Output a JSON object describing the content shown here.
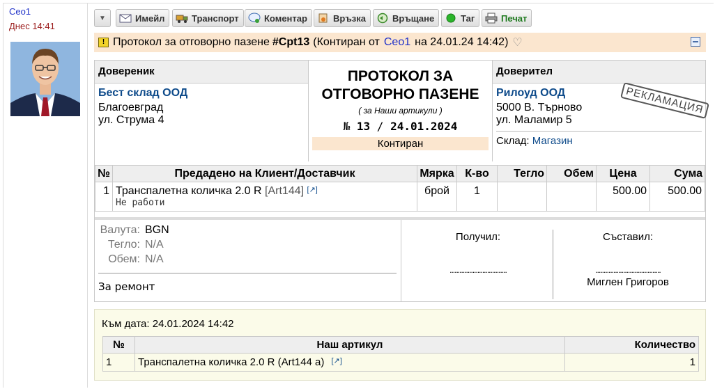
{
  "author": {
    "name": "Ceo1",
    "time": "Днес 14:41"
  },
  "toolbar": {
    "email": "Имейл",
    "transport": "Транспорт",
    "comment": "Коментар",
    "link": "Връзка",
    "return": "Връщане",
    "tag": "Таг",
    "print": "Печат"
  },
  "title": {
    "warn": "!",
    "text": "Протокол за отговорно пазене",
    "number": "#Cpt13",
    "posted_prefix": "(Контиран от",
    "posted_by": "Ceo1",
    "posted_suffix": "на 24.01.24 14:42)"
  },
  "depositor": {
    "heading": "Довереник",
    "name": "Бест склад ООД",
    "city": "Благоевград",
    "street": "ул. Струма 4"
  },
  "center": {
    "line1": "ПРОТОКОЛ ЗА",
    "line2": "ОТГОВОРНО ПАЗЕНЕ",
    "subtitle": "( за Наши артикули )",
    "no_label": "№",
    "no": "13",
    "sep": "/",
    "date": "24.01.2024",
    "status": "Контиран"
  },
  "trustee": {
    "heading": "Доверител",
    "name": "Рилоуд ООД",
    "city": "5000 В. Търново",
    "street": "ул. Маламир 5",
    "store_label": "Склад:",
    "store": "Магазин",
    "stamp": "РЕКЛАМАЦИЯ"
  },
  "items": {
    "headers": [
      "№",
      "Предадено на Клиент/Доставчик",
      "Мярка",
      "К-во",
      "Тегло",
      "Обем",
      "Цена",
      "Сума"
    ],
    "rows": [
      {
        "n": "1",
        "name": "Транспалетна количка 2.0 R",
        "code": "Art144",
        "note": "Не работи",
        "unit": "брой",
        "qty": "1",
        "weight": "",
        "volume": "",
        "price": "500.00",
        "amount": "500.00"
      }
    ],
    "ext_icon": "[↗]"
  },
  "totals": {
    "currency_label": "Валута:",
    "currency": "BGN",
    "weight_label": "Тегло:",
    "weight": "N/A",
    "volume_label": "Обем:",
    "volume": "N/A",
    "remark": "За ремонт"
  },
  "signatures": {
    "received_label": "Получил:",
    "received_dots": "...................................",
    "composed_label": "Съставил:",
    "composed_dots": "........................................",
    "composed_name": "Миглен Григоров"
  },
  "annex": {
    "date": "Към дата: 24.01.2024 14:42",
    "headers": [
      "№",
      "Наш артикул",
      "Количество"
    ],
    "rows": [
      {
        "n": "1",
        "name": "Транспалетна количка 2.0 R (Art144 а)",
        "qty": "1"
      }
    ],
    "ext_icon": "[↗]"
  }
}
